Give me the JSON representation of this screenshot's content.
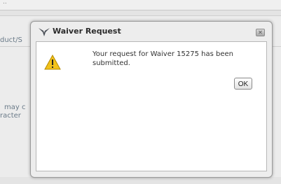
{
  "background": {
    "field_label": "duct/S",
    "note_line1": "may c",
    "note_line2": "racter"
  },
  "dialog": {
    "title": "Waiver Request",
    "logo_icon": "falcon-wings-icon",
    "close_icon": "close-icon",
    "warning_icon": "warning-triangle-icon",
    "message": "Your request for Waiver 15275 has been submitted.",
    "ok_label": "OK"
  },
  "colors": {
    "warning_yellow": "#f2c21a",
    "dialog_bg": "#ededed"
  }
}
